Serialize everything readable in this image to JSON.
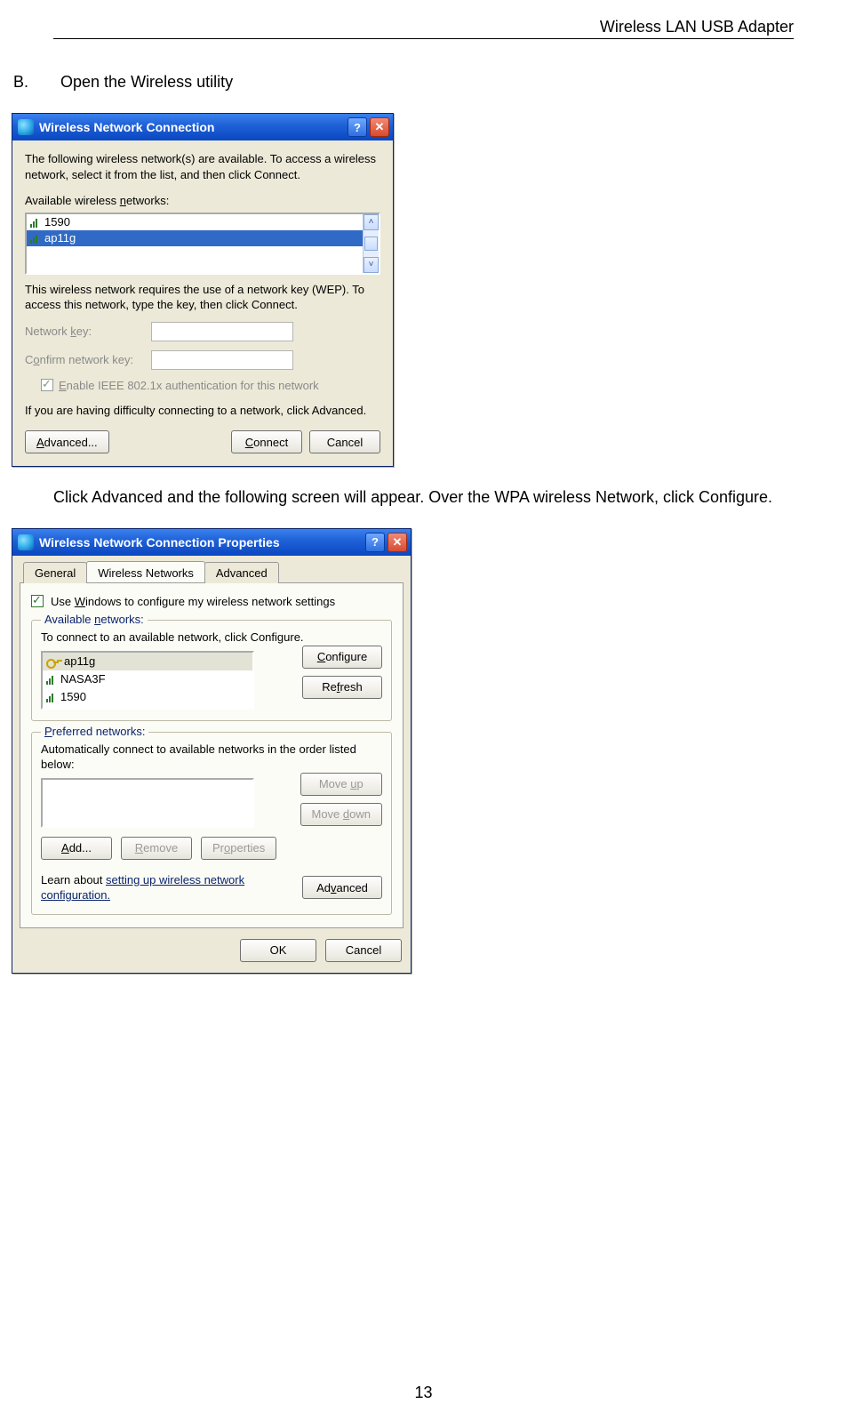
{
  "header": {
    "title": "Wireless LAN USB Adapter"
  },
  "page_number": "13",
  "section": {
    "letter": "B.",
    "title": "Open the Wireless utility"
  },
  "midtext": "Click Advanced and the following screen will appear. Over the WPA wireless Network, click Configure.",
  "dlg1": {
    "title": "Wireless Network Connection",
    "help": "?",
    "close": "✕",
    "intro": "The following wireless network(s) are available. To access a wireless network, select it from the list, and then click Connect.",
    "available_label_pre": "Available wireless ",
    "available_label_u": "n",
    "available_label_post": "etworks:",
    "networks": [
      "1590",
      "ap11g"
    ],
    "scroll_up": "˄",
    "scroll_down": "˅",
    "wep_note": "This wireless network requires the use of a network key (WEP). To access this network, type the key, then click Connect.",
    "netkey_pre": "Network ",
    "netkey_u": "k",
    "netkey_post": "ey:",
    "confirm_pre": "C",
    "confirm_u": "o",
    "confirm_post": "nfirm network key:",
    "enable_pre": "",
    "enable_u": "E",
    "enable_post": "nable IEEE 802.1x authentication for this network",
    "trouble": "If you are having difficulty connecting to a network, click Advanced.",
    "btn_adv_u": "A",
    "btn_adv_rest": "dvanced...",
    "btn_connect_u": "C",
    "btn_connect_rest": "onnect",
    "btn_cancel": "Cancel"
  },
  "dlg2": {
    "title": "Wireless Network Connection Properties",
    "tab_general": "General",
    "tab_wireless": "Wireless Networks",
    "tab_advanced": "Advanced",
    "use_win_pre": "Use ",
    "use_win_u": "W",
    "use_win_post": "indows to configure my wireless network settings",
    "grp_avail_pre": "Available ",
    "grp_avail_u": "n",
    "grp_avail_post": "etworks:",
    "avail_note": "To connect to an available network, click Configure.",
    "avail_items": [
      "ap11g",
      "NASA3F",
      "1590"
    ],
    "btn_configure_u": "C",
    "btn_configure_rest": "onfigure",
    "btn_refresh_pre": "Re",
    "btn_refresh_u": "f",
    "btn_refresh_post": "resh",
    "grp_pref_u": "P",
    "grp_pref_rest": "referred networks:",
    "pref_note": "Automatically connect to available networks in the order listed below:",
    "btn_moveup_pre": "Move ",
    "btn_moveup_u": "u",
    "btn_moveup_post": "p",
    "btn_movedown_pre": "Move ",
    "btn_movedown_u": "d",
    "btn_movedown_post": "own",
    "btn_add_u": "A",
    "btn_add_rest": "dd...",
    "btn_remove_u": "R",
    "btn_remove_rest": "emove",
    "btn_props_pre": "Pr",
    "btn_props_u": "o",
    "btn_props_post": "perties",
    "learn_pre": "Learn about ",
    "learn_link": "setting up wireless network configuration.",
    "btn_adv2_pre": "Ad",
    "btn_adv2_u": "v",
    "btn_adv2_post": "anced",
    "btn_ok": "OK",
    "btn_cancel": "Cancel"
  }
}
